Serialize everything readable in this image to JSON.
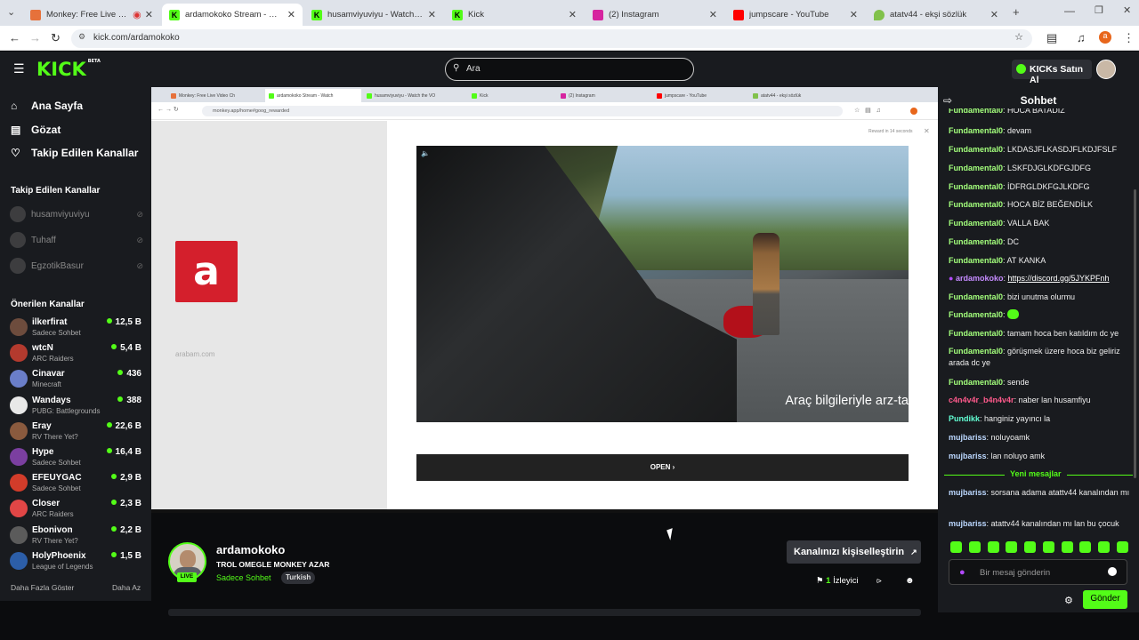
{
  "browser": {
    "tabs": [
      {
        "label": "Monkey: Free Live Video Ch",
        "color": "#e6713b"
      },
      {
        "label": "ardamokoko Stream - Watch L",
        "color": "#53fc18"
      },
      {
        "label": "husamviyuviyu - Watch the VO",
        "color": "#53fc18"
      },
      {
        "label": "Kick",
        "color": "#53fc18"
      },
      {
        "label": "(2) Instagram",
        "color": "#d6249f"
      },
      {
        "label": "jumpscare - YouTube",
        "color": "#ff0000"
      },
      {
        "label": "atatv44 - ekşi sözlük",
        "color": "#81c14b"
      }
    ],
    "url": "kick.com/ardamokoko"
  },
  "header": {
    "logo": "KICK",
    "logo_badge": "BETA",
    "search_placeholder": "Ara",
    "ai_button": "KICKs Satın Al"
  },
  "sidebar": {
    "nav": [
      {
        "label": "Ana Sayfa",
        "icon": "home-icon"
      },
      {
        "label": "Gözat",
        "icon": "browse-icon"
      },
      {
        "label": "Takip Edilen Kanallar",
        "icon": "heart-icon"
      }
    ],
    "followed_title": "Takip Edilen Kanallar",
    "followed": [
      {
        "name": "husamviyuviyu"
      },
      {
        "name": "Tuhaff"
      },
      {
        "name": "EgzotikBasur"
      }
    ],
    "recommended_title": "Önerilen Kanallar",
    "recommended": [
      {
        "name": "ilkerfirat",
        "category": "Sadece Sohbet",
        "viewers": "12,5 B",
        "color": "#6d4c3d"
      },
      {
        "name": "wtcN",
        "category": "ARC Raiders",
        "viewers": "5,4 B",
        "color": "#b33a2e"
      },
      {
        "name": "Cinavar",
        "category": "Minecraft",
        "viewers": "436",
        "color": "#6a7ec9"
      },
      {
        "name": "Wandays",
        "category": "PUBG: Battlegrounds",
        "viewers": "388",
        "color": "#e8e8e8"
      },
      {
        "name": "Eray",
        "category": "RV There Yet?",
        "viewers": "22,6 B",
        "color": "#8a5a3e"
      },
      {
        "name": "Hype",
        "category": "Sadece Sohbet",
        "viewers": "16,4 B",
        "color": "#7b3fa0"
      },
      {
        "name": "EFEUYGAC",
        "category": "Sadece Sohbet",
        "viewers": "2,9 B",
        "color": "#d23c2a"
      },
      {
        "name": "Closer",
        "category": "ARC Raiders",
        "viewers": "2,3 B",
        "color": "#e14646"
      },
      {
        "name": "Ebonivon",
        "category": "RV There Yet?",
        "viewers": "2,2 B",
        "color": "#5b5b5b"
      },
      {
        "name": "HolyPhoenix",
        "category": "League of Legends",
        "viewers": "1,5 B",
        "color": "#2c5ea8"
      }
    ],
    "show_more": "Daha Fazla Göster",
    "show_less": "Daha Az"
  },
  "stream": {
    "inner_url": "monkey.app/home#goog_rewarded",
    "inner_remote": "Reward in 14 seconds",
    "arabam_text": "arabam.com",
    "ad_logo": "a",
    "video_caption": "Araç bilgileriyle arz-ta",
    "open_label": "OPEN",
    "inner_tabs": [
      {
        "label": "Monkey: Free Live Video Ch",
        "color": "#e6713b"
      },
      {
        "label": "ardamokoko Stream - Watch",
        "color": "#53fc18"
      },
      {
        "label": "husamviyuviyu - Watch the VO",
        "color": "#53fc18"
      },
      {
        "label": "Kick",
        "color": "#53fc18"
      },
      {
        "label": "(2) Instagram",
        "color": "#d6249f"
      },
      {
        "label": "jumpscare - YouTube",
        "color": "#ff0000"
      },
      {
        "label": "atatv44 - ekşi sözlük",
        "color": "#81c14b"
      }
    ]
  },
  "channel": {
    "name": "ardamokoko",
    "title": "TROL OMEGLE MONKEY AZAR",
    "category": "Sadece Sohbet",
    "tag": "Turkish",
    "live": "LIVE",
    "customize": "Kanalınızı kişiselleştirin",
    "viewers_count": "1",
    "viewers_label": "İzleyici"
  },
  "chat": {
    "title": "Sohbet",
    "messages": [
      {
        "user": "Fundamental0",
        "text": "HOCA BATADIZ",
        "color": "#a3ff7c"
      },
      {
        "user": "Fundamental0",
        "text": "devam",
        "color": "#a3ff7c"
      },
      {
        "user": "Fundamental0",
        "text": "LKDASJFLKASDJFLKDJFSLF",
        "color": "#a3ff7c"
      },
      {
        "user": "Fundamental0",
        "text": "LSKFDJGLKDFGJDFG",
        "color": "#a3ff7c"
      },
      {
        "user": "Fundamental0",
        "text": "İDFRGLDKFGJLKDFG",
        "color": "#a3ff7c"
      },
      {
        "user": "Fundamental0",
        "text": "HOCA BİZ BEĞENDİLK",
        "color": "#a3ff7c"
      },
      {
        "user": "Fundamental0",
        "text": "VALLA BAK",
        "color": "#a3ff7c"
      },
      {
        "user": "Fundamental0",
        "text": "DC",
        "color": "#a3ff7c"
      },
      {
        "user": "Fundamental0",
        "text": "AT KANKA",
        "color": "#a3ff7c"
      },
      {
        "user": "ardamokoko",
        "text": "https://discord.gg/5JYKPFnh",
        "color": "#c58bff",
        "link": true
      },
      {
        "user": "Fundamental0",
        "text": "bizi unutma olurmu",
        "color": "#a3ff7c"
      },
      {
        "user": "Fundamental0",
        "text": "",
        "color": "#a3ff7c",
        "emote": true
      },
      {
        "user": "Fundamental0",
        "text": "tamam hoca ben katıldım dc ye",
        "color": "#a3ff7c"
      },
      {
        "user": "Fundamental0",
        "text": "görüşmek üzere hoca biz geliriz arada dc ye",
        "color": "#a3ff7c"
      },
      {
        "user": "Fundamental0",
        "text": "sende",
        "color": "#a3ff7c"
      },
      {
        "user": "c4n4v4r_b4n4v4r",
        "text": "naber lan husamfiyu",
        "color": "#ff5a8c"
      },
      {
        "user": "Pundikk",
        "text": "hanginiz yayıncı la",
        "color": "#62ffd4"
      },
      {
        "user": "mujbariss",
        "text": "noluyoamk",
        "color": "#bcd8ff"
      },
      {
        "user": "mujbariss",
        "text": "lan noluyo amk",
        "color": "#bcd8ff"
      },
      {
        "user": "mujbariss",
        "text": "sorsana adama atattv44 kanalından mı",
        "color": "#bcd8ff"
      },
      {
        "user": "mujbariss",
        "text": "atattv44 kanalından mı lan bu çocuk",
        "color": "#bcd8ff"
      }
    ],
    "new_messages": "Yeni mesajlar",
    "input_placeholder": "Bir mesaj gönderin",
    "send": "Gönder"
  }
}
